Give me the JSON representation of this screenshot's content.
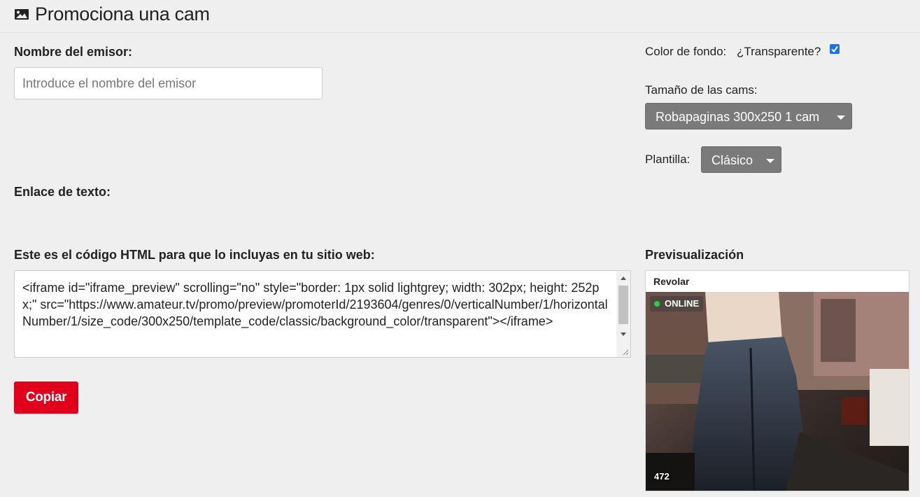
{
  "header": {
    "title": "Promociona una cam",
    "icon": "image-icon"
  },
  "form": {
    "emitter_label": "Nombre del emisor:",
    "emitter_placeholder": "Introduce el nombre del emisor",
    "emitter_value": "",
    "text_link_label": "Enlace de texto:",
    "code_label": "Este es el código HTML para que lo incluyas en tu sitio web:",
    "code_value": "<iframe id=\"iframe_preview\" scrolling=\"no\" style=\"border: 1px solid lightgrey; width: 302px; height: 252px;\" src=\"https://www.amateur.tv/promo/preview/promoterId/2193604/genres/0/verticalNumber/1/horizontalNumber/1/size_code/300x250/template_code/classic/background_color/transparent\"></iframe>",
    "copy_label": "Copiar"
  },
  "settings": {
    "bg_color_label": "Color de fondo:",
    "transparent_label": "¿Transparente?",
    "transparent_checked": true,
    "size_label": "Tamaño de las cams:",
    "size_value": "Robapaginas 300x250 1 cam",
    "template_label": "Plantilla:",
    "template_value": "Clásico"
  },
  "preview": {
    "title": "Previsualización",
    "cam_name": "Revolar",
    "status": "ONLINE",
    "viewers": "472"
  },
  "colors": {
    "accent_red": "#e0001b",
    "select_grey": "#7a7a7a",
    "online_green": "#2ecc40",
    "checkbox_blue": "#1a73e8"
  }
}
